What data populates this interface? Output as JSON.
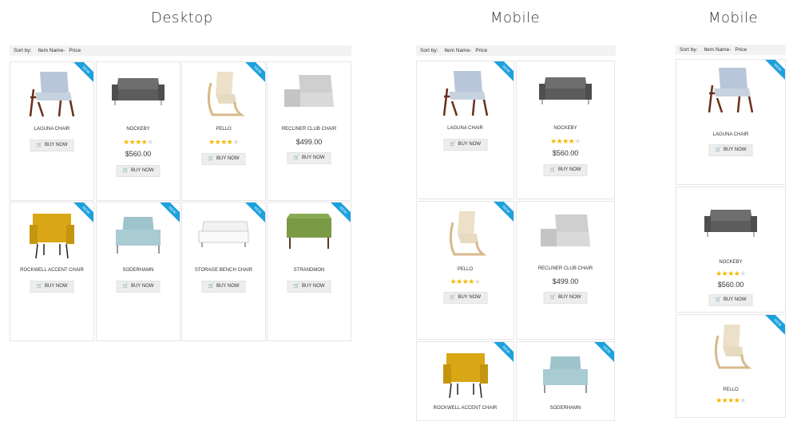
{
  "titles": {
    "desktop": "Desktop",
    "mobile_tablet": "Mobile",
    "mobile_phone": "Mobile"
  },
  "sortbar": {
    "label": "Sort by:",
    "item_name": "Item Name-",
    "price": "Price"
  },
  "ribbon_text": "NEW",
  "buy_label": "BUY NOW",
  "colors": {
    "ribbon": "#1da1dc",
    "star": "#f5b800",
    "button_bg": "#ededed"
  },
  "products": [
    {
      "name": "LAGUNA CHAIR",
      "rating": null,
      "price": ""
    },
    {
      "name": "NOCKEBY",
      "rating": 4,
      "price": "$560.00"
    },
    {
      "name": "PELLO",
      "rating": 4,
      "price": ""
    },
    {
      "name": "RECLINER CLUB CHAIR",
      "rating": null,
      "price": "$499.00"
    },
    {
      "name": "ROCKWELL ACCENT CHAIR",
      "rating": null,
      "price": ""
    },
    {
      "name": "SODERHAMN",
      "rating": null,
      "price": ""
    },
    {
      "name": "STORAGE BENCH CHAIR",
      "rating": null,
      "price": ""
    },
    {
      "name": "STRANDMON",
      "rating": null,
      "price": ""
    }
  ]
}
